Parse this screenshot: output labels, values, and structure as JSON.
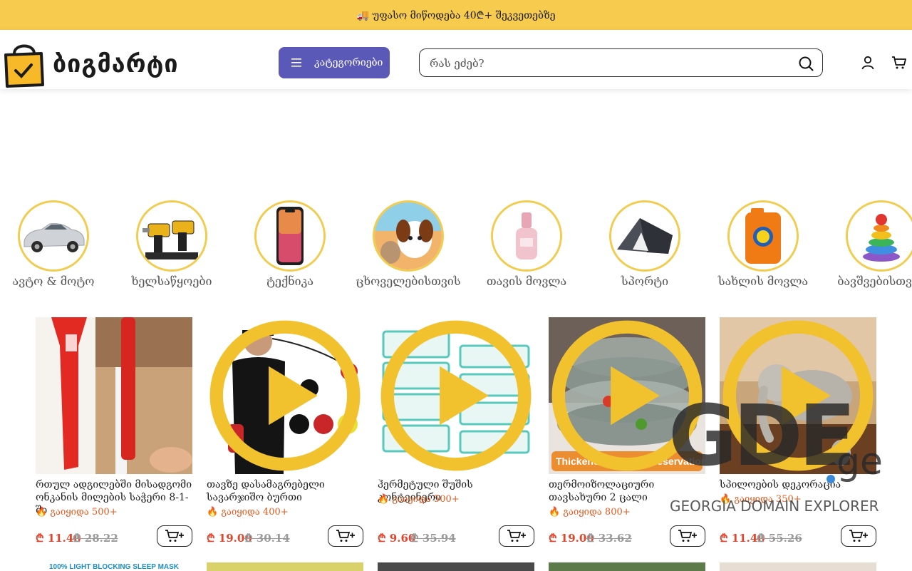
{
  "promo": {
    "text": "🚚 უფასო მიწოდება 40₾+ შეკვეთებზე"
  },
  "header": {
    "brand": "ბიგმარტი",
    "categories_button": "კატეგორიები",
    "search_placeholder": "რას ეძებ?"
  },
  "categories": [
    {
      "label": "ავტო & მოტო",
      "icon": "car-image"
    },
    {
      "label": "ხელსაწყოები",
      "icon": "tools-image"
    },
    {
      "label": "ტექნიკა",
      "icon": "phone-image"
    },
    {
      "label": "ცხოველებისთვის",
      "icon": "pets-image"
    },
    {
      "label": "თავის მოვლა",
      "icon": "serum-image"
    },
    {
      "label": "სპორტი",
      "icon": "tent-image"
    },
    {
      "label": "სახლის მოვლა",
      "icon": "detergent-image"
    },
    {
      "label": "ბავშვებისთვის",
      "icon": "toy-image"
    }
  ],
  "products": [
    {
      "title": "რთულ ადგილებში მისადგომი ონკანის მილების საჭერი 8-1-ში",
      "sold": "🔥 გაიყიდა 500+",
      "price": "₾ 11.40",
      "old_price": "₾ 28.22",
      "has_video": false,
      "image": "wrench-image"
    },
    {
      "title": "თავზე დასამაგრებელი სავარჯიშო ბურთი",
      "sold": "🔥 გაიყიდა 400+",
      "price": "₾ 19.00",
      "old_price": "₾ 30.14",
      "has_video": true,
      "image": "boxing-ball-image"
    },
    {
      "title": "ჰერმეტული შუშის კონტეინერი",
      "sold": "🔥 გაიყიდა 500+",
      "price": "₾ 9.60",
      "old_price": "₾ 35.94",
      "has_video": true,
      "image": "glass-containers-image"
    },
    {
      "title": "თერმოიზოლაციური თავსახური 2 ცალი",
      "sold": "🔥 გაიყიდა 800+",
      "price": "₾ 19.00",
      "old_price": "₾ 33.62",
      "has_video": true,
      "image": "food-covers-image",
      "image_caption": "Thickened for heat preservation"
    },
    {
      "title": "სპილოების დეკორაცია",
      "sold": "🔥 გაიყიდა 350+",
      "price": "₾ 11.40",
      "old_price": "₾ 55.26",
      "has_video": true,
      "image": "elephants-image"
    }
  ],
  "row2_first_caption": "100% LIGHT BLOCKING SLEEP MASK",
  "watermark": {
    "big": "GDE",
    "suffix": "ge",
    "subtitle": "GEORGIA DOMAIN EXPLORER"
  },
  "colors": {
    "promo_bar": "#f7cb4d",
    "category_button": "#5b59b8",
    "category_ring": "#f1cc4e",
    "price": "#e4432c",
    "sold": "#e45b1f"
  }
}
